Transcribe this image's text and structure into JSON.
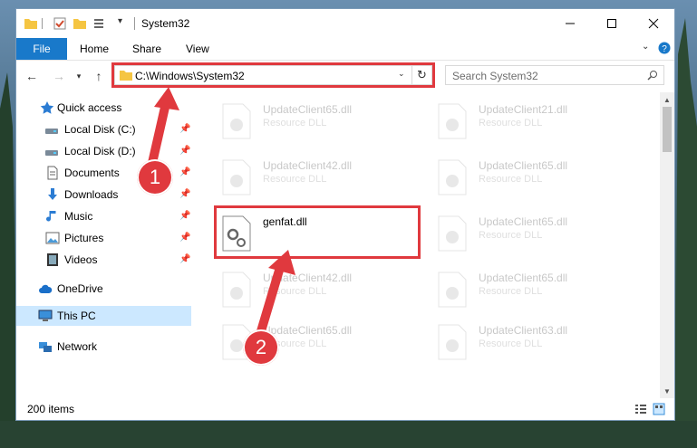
{
  "window": {
    "title": "System32",
    "controls": {
      "minimize": "minimize",
      "maximize": "maximize",
      "close": "close"
    }
  },
  "ribbon": {
    "tabs": [
      "File",
      "Home",
      "Share",
      "View"
    ]
  },
  "address": {
    "path": "C:\\Windows\\System32",
    "search_placeholder": "Search System32"
  },
  "sidebar": {
    "items": [
      {
        "label": "Quick access",
        "icon": "star-icon",
        "pinned": false
      },
      {
        "label": "Local Disk (C:)",
        "icon": "drive-icon",
        "pinned": true
      },
      {
        "label": "Local Disk (D:)",
        "icon": "drive-icon",
        "pinned": true
      },
      {
        "label": "Documents",
        "icon": "document-icon",
        "pinned": true
      },
      {
        "label": "Downloads",
        "icon": "download-icon",
        "pinned": true
      },
      {
        "label": "Music",
        "icon": "music-icon",
        "pinned": true
      },
      {
        "label": "Pictures",
        "icon": "pictures-icon",
        "pinned": true
      },
      {
        "label": "Videos",
        "icon": "video-icon",
        "pinned": true
      },
      {
        "label": "OneDrive",
        "icon": "cloud-icon",
        "pinned": false
      },
      {
        "label": "This PC",
        "icon": "computer-icon",
        "pinned": false,
        "selected": true
      },
      {
        "label": "Network",
        "icon": "network-icon",
        "pinned": false
      }
    ]
  },
  "files": [
    {
      "name": "UpdateClient65.dll",
      "type": "Resource DLL",
      "faded": true
    },
    {
      "name": "UpdateClient21.dll",
      "type": "Resource DLL",
      "faded": true
    },
    {
      "name": "UpdateClient42.dll",
      "type": "Resource DLL",
      "faded": true
    },
    {
      "name": "UpdateClient65.dll",
      "type": "Resource DLL",
      "faded": true
    },
    {
      "name": "genfat.dll",
      "type": "",
      "faded": false
    },
    {
      "name": "UpdateClient65.dll",
      "type": "Resource DLL",
      "faded": true
    },
    {
      "name": "UpdateClient42.dll",
      "type": "Resource DLL",
      "faded": true
    },
    {
      "name": "UpdateClient65.dll",
      "type": "Resource DLL",
      "faded": true
    },
    {
      "name": "UpdateClient65.dll",
      "type": "Resource DLL",
      "faded": true
    },
    {
      "name": "UpdateClient63.dll",
      "type": "Resource DLL",
      "faded": true
    }
  ],
  "status": {
    "item_count": "200 items"
  },
  "annotations": {
    "step1": "1",
    "step2": "2",
    "color": "#e0393e"
  }
}
